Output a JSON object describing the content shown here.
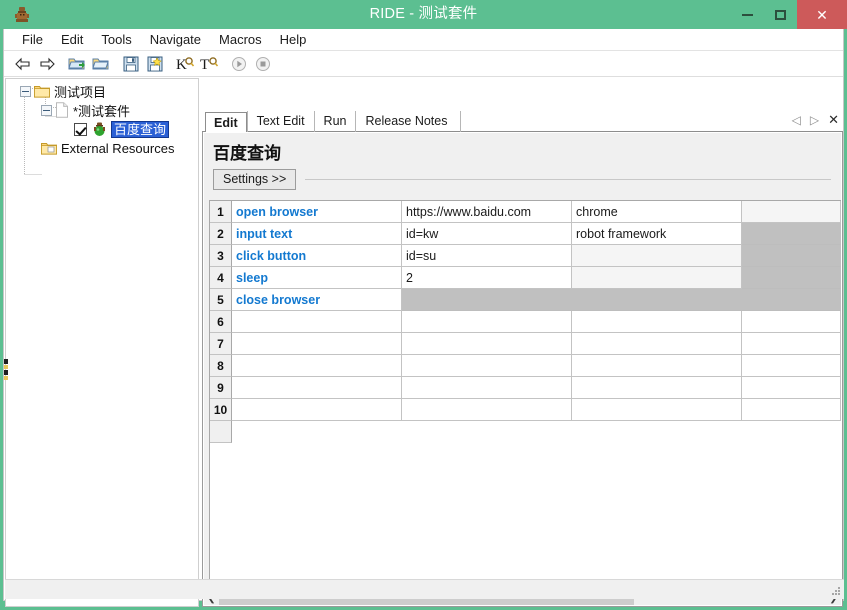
{
  "window": {
    "title": "RIDE - 测试套件",
    "app_icon": "robot-icon",
    "minimize_label": "Minimize",
    "maximize_label": "Maximize",
    "close_label": "✕",
    "titlebar_color": "#5cbf91",
    "close_button_color": "#cd5a5a"
  },
  "menubar": {
    "items": [
      {
        "label": "File"
      },
      {
        "label": "Edit"
      },
      {
        "label": "Tools"
      },
      {
        "label": "Navigate"
      },
      {
        "label": "Macros"
      },
      {
        "label": "Help"
      }
    ]
  },
  "toolbar": {
    "buttons": [
      {
        "name": "back-arrow-icon",
        "title": "Back"
      },
      {
        "name": "forward-arrow-icon",
        "title": "Forward"
      },
      {
        "name": "open-directory-icon",
        "title": "Open Directory"
      },
      {
        "name": "open-folder-icon",
        "title": "Open"
      },
      {
        "name": "save-icon",
        "title": "Save"
      },
      {
        "name": "save-all-icon",
        "title": "Save All"
      },
      {
        "name": "search-keyword-icon",
        "title": "K"
      },
      {
        "name": "search-tests-icon",
        "title": "T"
      },
      {
        "name": "run-icon",
        "title": "Run"
      },
      {
        "name": "stop-icon",
        "title": "Stop"
      }
    ]
  },
  "tree": {
    "nodes": [
      {
        "label": "测试项目",
        "icon": "folder-icon",
        "expander": "minus",
        "selected": false,
        "checkbox": false
      },
      {
        "label": "*测试套件",
        "icon": "document-icon",
        "expander": "minus",
        "selected": false,
        "checkbox": false
      },
      {
        "label": "百度查询",
        "icon": "robot-green-icon",
        "expander": "none",
        "selected": true,
        "checkbox": true
      },
      {
        "label": "External Resources",
        "icon": "resource-folder-icon",
        "expander": "none",
        "selected": false,
        "checkbox": false
      }
    ],
    "selection_bg": "#2b60d5",
    "selection_fg": "#ffffff"
  },
  "editor": {
    "tabs": [
      {
        "label": "Edit",
        "active": true
      },
      {
        "label": "Text Edit",
        "active": false
      },
      {
        "label": "Run",
        "active": false
      },
      {
        "label": "Release Notes",
        "active": false
      }
    ],
    "tab_nav": {
      "prev": "◁",
      "next": "▷",
      "close": "✕"
    },
    "test_case_title": "百度查询",
    "settings_button": "Settings >>",
    "grid": {
      "rows": [
        {
          "num": "1",
          "cells": [
            {
              "value": "open browser",
              "kind": "keyword"
            },
            {
              "value": "https://www.baidu.com",
              "kind": "arg"
            },
            {
              "value": "chrome",
              "kind": "arg"
            },
            {
              "value": "",
              "kind": "empty-light"
            }
          ]
        },
        {
          "num": "2",
          "cells": [
            {
              "value": "input text",
              "kind": "keyword"
            },
            {
              "value": "id=kw",
              "kind": "arg"
            },
            {
              "value": "robot framework",
              "kind": "arg"
            },
            {
              "value": "",
              "kind": "disabled"
            }
          ]
        },
        {
          "num": "3",
          "cells": [
            {
              "value": "click button",
              "kind": "keyword"
            },
            {
              "value": "id=su",
              "kind": "arg"
            },
            {
              "value": "",
              "kind": "empty-light"
            },
            {
              "value": "",
              "kind": "disabled"
            }
          ]
        },
        {
          "num": "4",
          "cells": [
            {
              "value": "sleep",
              "kind": "keyword"
            },
            {
              "value": "2",
              "kind": "arg"
            },
            {
              "value": "",
              "kind": "empty-light"
            },
            {
              "value": "",
              "kind": "disabled"
            }
          ]
        },
        {
          "num": "5",
          "cells": [
            {
              "value": "close browser",
              "kind": "keyword"
            },
            {
              "value": "",
              "kind": "disabled"
            },
            {
              "value": "",
              "kind": "disabled"
            },
            {
              "value": "",
              "kind": "disabled"
            }
          ]
        },
        {
          "num": "6",
          "cells": [
            {
              "value": "",
              "kind": "arg"
            },
            {
              "value": "",
              "kind": "arg"
            },
            {
              "value": "",
              "kind": "arg"
            },
            {
              "value": "",
              "kind": "arg"
            }
          ]
        },
        {
          "num": "7",
          "cells": [
            {
              "value": "",
              "kind": "arg"
            },
            {
              "value": "",
              "kind": "arg"
            },
            {
              "value": "",
              "kind": "arg"
            },
            {
              "value": "",
              "kind": "arg"
            }
          ]
        },
        {
          "num": "8",
          "cells": [
            {
              "value": "",
              "kind": "arg"
            },
            {
              "value": "",
              "kind": "arg"
            },
            {
              "value": "",
              "kind": "arg"
            },
            {
              "value": "",
              "kind": "arg"
            }
          ]
        },
        {
          "num": "9",
          "cells": [
            {
              "value": "",
              "kind": "arg"
            },
            {
              "value": "",
              "kind": "arg"
            },
            {
              "value": "",
              "kind": "arg"
            },
            {
              "value": "",
              "kind": "arg"
            }
          ]
        },
        {
          "num": "10",
          "cells": [
            {
              "value": "",
              "kind": "arg"
            },
            {
              "value": "",
              "kind": "arg"
            },
            {
              "value": "",
              "kind": "arg"
            },
            {
              "value": "",
              "kind": "arg"
            }
          ]
        }
      ],
      "keyword_color": "#1379d0",
      "disabled_color": "#c0c0c0"
    },
    "hscroll": {
      "left_arrow": "❮",
      "right_arrow": "❯"
    }
  },
  "statusbar": {
    "text": ""
  }
}
